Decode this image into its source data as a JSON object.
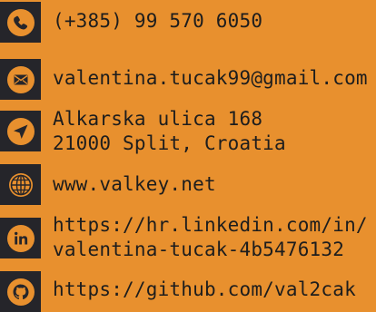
{
  "contact": {
    "phone": {
      "icon": "phone-icon",
      "text": "(+385) 99 570 6050"
    },
    "email": {
      "icon": "envelope-icon",
      "text": "valentina.tucak99@gmail.com"
    },
    "address": {
      "icon": "location-arrow-icon",
      "line1": "Alkarska ulica 168",
      "line2": "21000 Split, Croatia"
    },
    "website": {
      "icon": "globe-icon",
      "text": "www.valkey.net"
    },
    "linkedin": {
      "icon": "linkedin-icon",
      "line1": "https://hr.linkedin.com/in/",
      "line2": "valentina-tucak-4b5476132"
    },
    "github": {
      "icon": "github-icon",
      "text": "https://github.com/val2cak"
    }
  },
  "colors": {
    "background": "#e8902e",
    "icon_tile": "#25252a",
    "icon_glyph": "#e8902e",
    "text": "#1d1d1d"
  }
}
